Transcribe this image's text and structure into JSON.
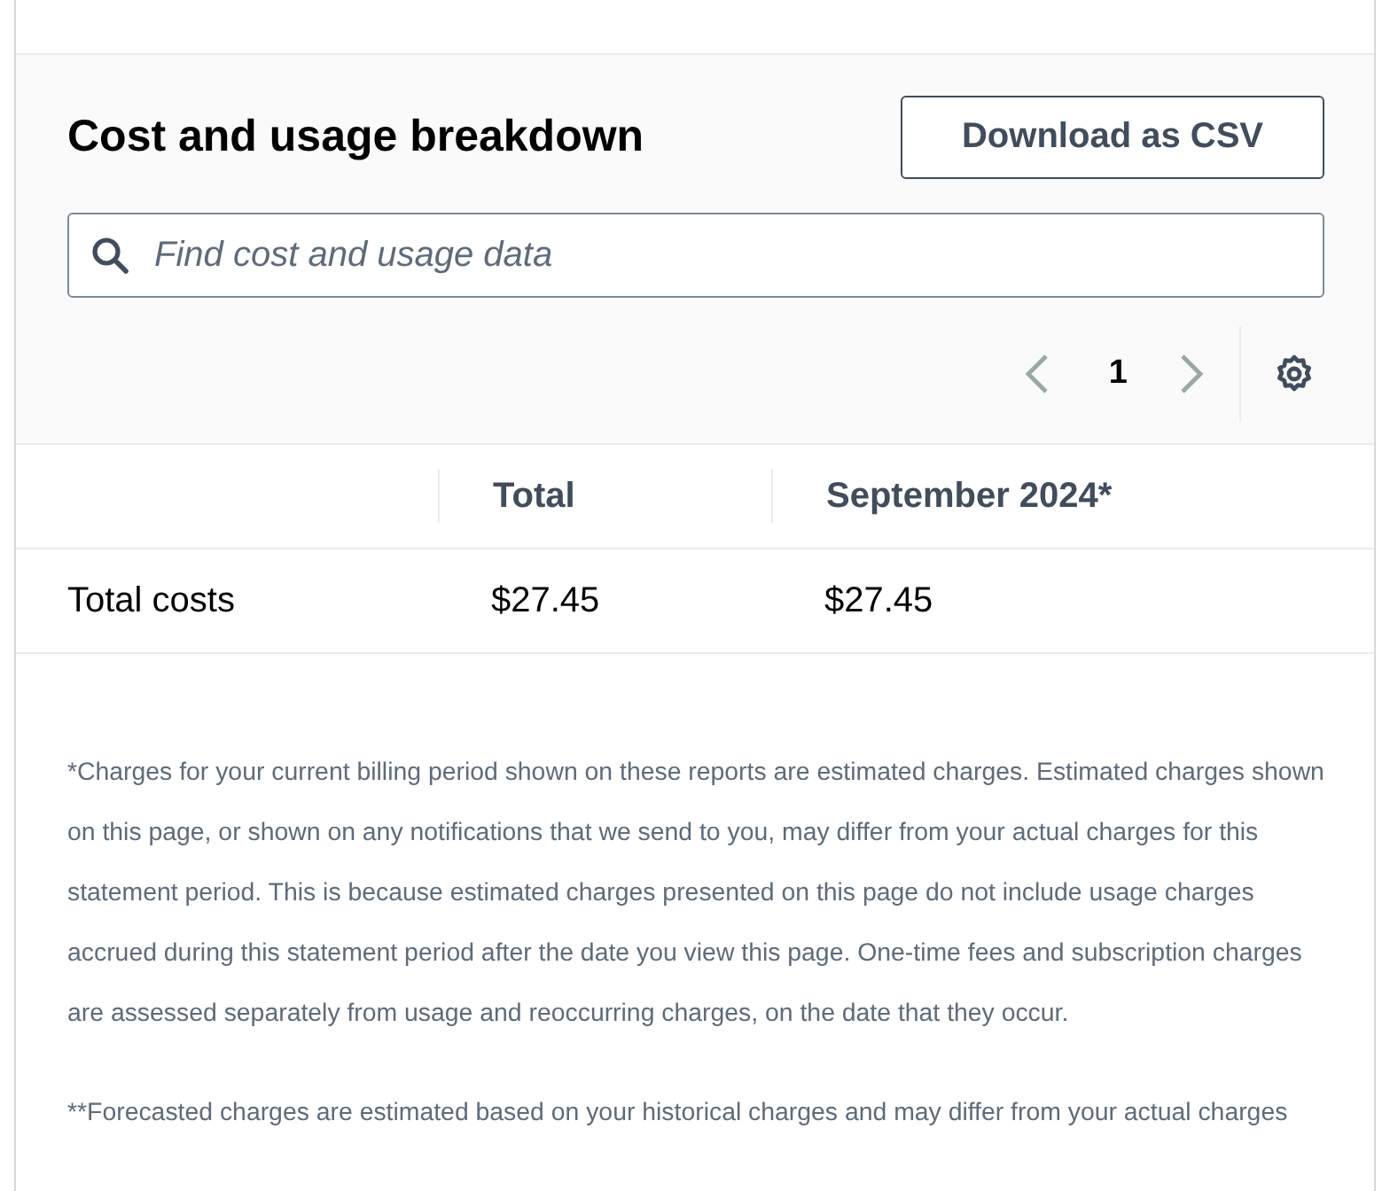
{
  "header": {
    "title": "Cost and usage breakdown",
    "download_button": "Download as CSV"
  },
  "search": {
    "placeholder": "Find cost and usage data"
  },
  "pagination": {
    "prev_disabled": true,
    "current_page": "1",
    "next_disabled": true
  },
  "table": {
    "columns": [
      "",
      "Total",
      "September 2024*"
    ],
    "rows": [
      [
        "Total costs",
        "$27.45",
        "$27.45"
      ]
    ]
  },
  "footnotes": [
    "*Charges for your current billing period shown on these reports are estimated charges. Estimated charges shown on this page, or shown on any notifications that we send to you, may differ from your actual charges for this statement period. This is because estimated charges presented on this page do not include usage charges accrued during this statement period after the date you view this page. One-time fees and subscription charges are assessed separately from usage and reoccurring charges, on the date that they occur.",
    "**Forecasted charges are estimated based on your historical charges and may differ from your actual charges"
  ]
}
